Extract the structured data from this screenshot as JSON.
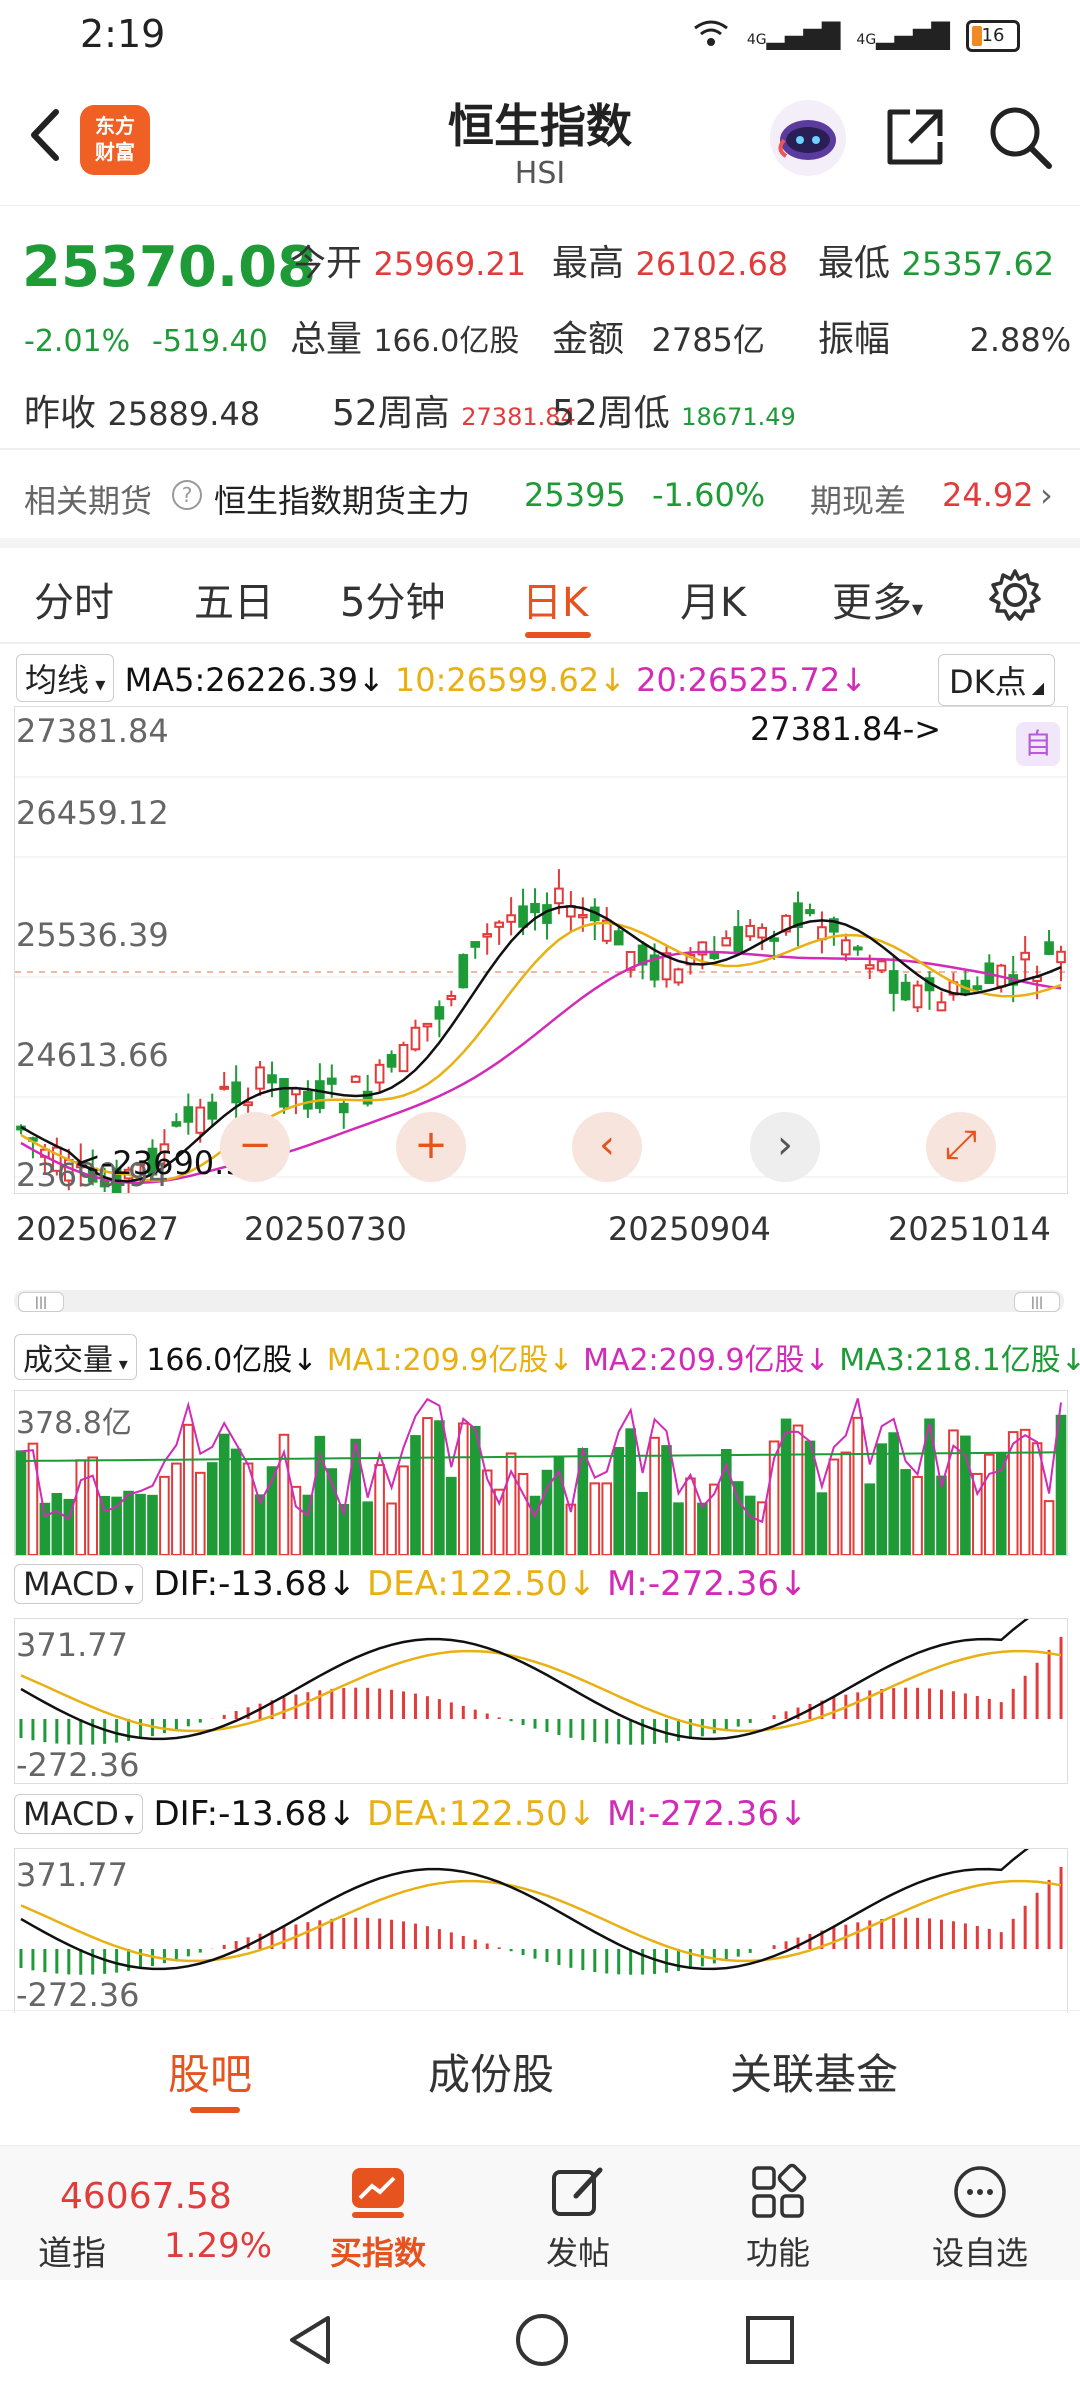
{
  "status": {
    "time": "2:19",
    "battery": "16",
    "signal1": "4G",
    "signal2": "4G"
  },
  "header": {
    "logo_line1": "东方",
    "logo_line2": "财富",
    "title": "恒生指数",
    "subtitle": "HSI"
  },
  "quote": {
    "price": "25370.08",
    "change_pct": "-2.01%",
    "change": "-519.40",
    "open_label": "今开",
    "open": "25969.21",
    "high_label": "最高",
    "high": "26102.68",
    "low_label": "最低",
    "low": "25357.62",
    "volume_label": "总量",
    "volume": "166.0亿股",
    "amount_label": "金额",
    "amount": "2785亿",
    "amp_label": "振幅",
    "amp": "2.88%",
    "prev_label": "昨收",
    "prev": "25889.48",
    "w52h_label": "52周高",
    "w52h": "27381.84",
    "w52l_label": "52周低",
    "w52l": "18671.49"
  },
  "futures": {
    "label": "相关期货",
    "name": "恒生指数期货主力",
    "price": "25395",
    "pct": "-1.60%",
    "basis_label": "期现差",
    "basis": "24.92"
  },
  "tabs": [
    "分时",
    "五日",
    "5分钟",
    "日K",
    "月K",
    "更多"
  ],
  "kline": {
    "ma_selector": "均线",
    "ma5": "MA5:26226.39↓",
    "ma10": "10:26599.62↓",
    "ma20": "20:26525.72↓",
    "dk": "DK点",
    "zi": "自",
    "y_labels": [
      "27381.84",
      "26459.12",
      "25536.39",
      "24613.66",
      "23690.94"
    ],
    "max_note": "27381.84->",
    "min_note": "<-23690.94",
    "x_labels": [
      "20250627",
      "20250730",
      "20250904",
      "20251014"
    ]
  },
  "volume": {
    "selector": "成交量",
    "value": "166.0亿股↓",
    "ma1": "MA1:209.9亿股↓",
    "ma2": "MA2:209.9亿股↓",
    "ma3": "MA3:218.1亿股↓",
    "max": "378.8亿"
  },
  "macd1": {
    "selector": "MACD",
    "dif": "DIF:-13.68↓",
    "dea": "DEA:122.50↓",
    "m": "M:-272.36↓",
    "top": "371.77",
    "bottom": "-272.36"
  },
  "macd2": {
    "selector": "MACD",
    "dif": "DIF:-13.68↓",
    "dea": "DEA:122.50↓",
    "m": "M:-272.36↓",
    "top": "371.77",
    "bottom": "-272.36"
  },
  "bottom_tabs": [
    "股吧",
    "成份股",
    "关联基金"
  ],
  "bottom_bar": {
    "index_name": "道指",
    "index_value": "46067.58",
    "index_pct": "1.29%",
    "buy": "买指数",
    "post": "发帖",
    "func": "功能",
    "fav": "设自选"
  },
  "colors": {
    "up": "#e23b3b",
    "down": "#1e9a37",
    "accent": "#e6531f",
    "ma5": "#111111",
    "ma10": "#e8b012",
    "ma20": "#d12bb7"
  }
}
